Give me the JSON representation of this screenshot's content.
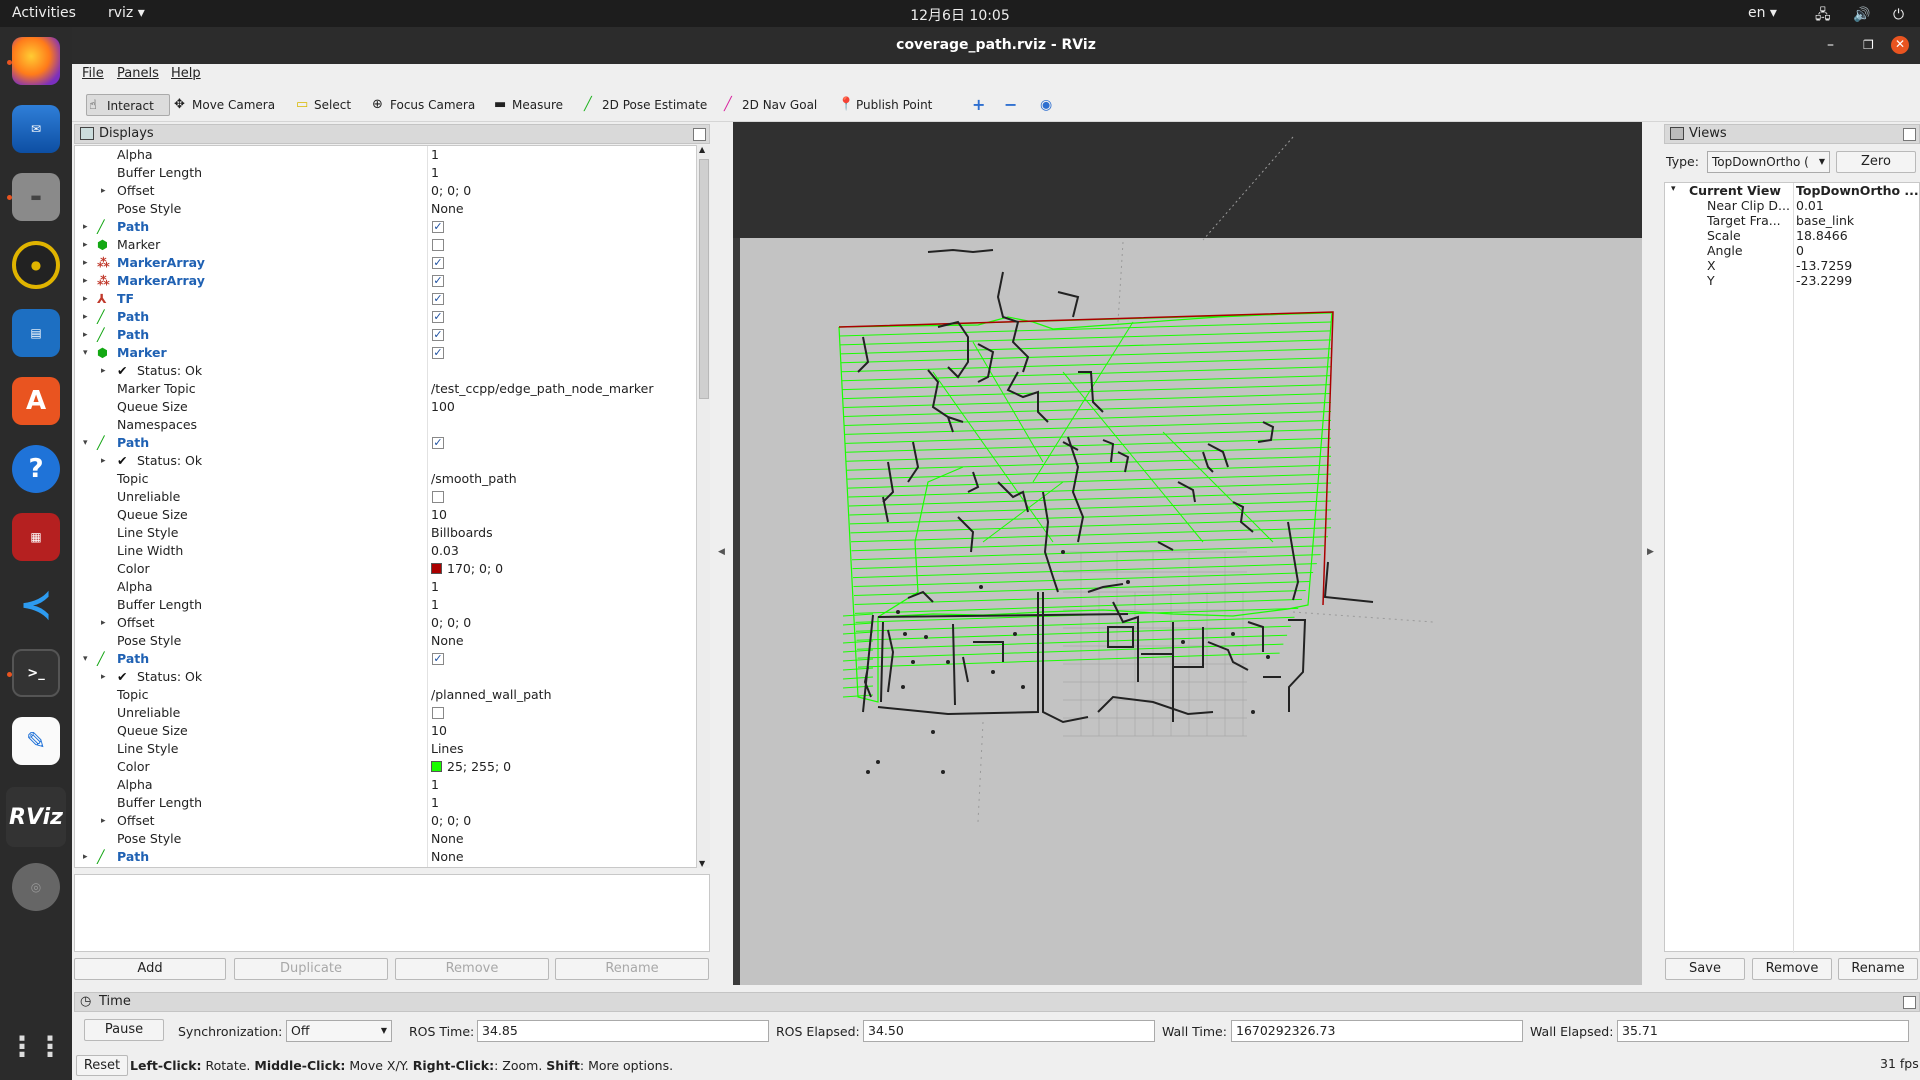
{
  "topbar": {
    "activities": "Activities",
    "app": "rviz ▾",
    "clock": "12月6日  10:05",
    "lang": "en ▾",
    "tray": "🖧 🔊 ⏻ ▾"
  },
  "window": {
    "title": "coverage_path.rviz - RViz"
  },
  "menu": {
    "file": "File",
    "panels": "Panels",
    "help": "Help"
  },
  "toolbar": {
    "interact": "Interact",
    "move_camera": "Move Camera",
    "select": "Select",
    "focus_camera": "Focus Camera",
    "measure": "Measure",
    "pose_estimate": "2D Pose Estimate",
    "nav_goal": "2D Nav Goal",
    "publish_point": "Publish Point"
  },
  "displays": {
    "header": "Displays",
    "rows": [
      {
        "name": "Alpha",
        "value": "1",
        "indent": 2
      },
      {
        "name": "Buffer Length",
        "value": "1",
        "indent": 2
      },
      {
        "name": "Offset",
        "value": "0; 0; 0",
        "indent": 2,
        "arrow": "▸"
      },
      {
        "name": "Pose Style",
        "value": "None",
        "indent": 2
      },
      {
        "name": "Path",
        "indent": 1,
        "arrow": "▸",
        "icon": "path",
        "blue": true,
        "check": true
      },
      {
        "name": "Marker",
        "indent": 1,
        "arrow": "▸",
        "icon": "marker",
        "check": false
      },
      {
        "name": "MarkerArray",
        "indent": 1,
        "arrow": "▸",
        "icon": "markerarray",
        "blue": true,
        "check": true
      },
      {
        "name": "MarkerArray",
        "indent": 1,
        "arrow": "▸",
        "icon": "markerarray",
        "blue": true,
        "check": true
      },
      {
        "name": "TF",
        "indent": 1,
        "arrow": "▸",
        "icon": "tf",
        "blue": true,
        "check": true
      },
      {
        "name": "Path",
        "indent": 1,
        "arrow": "▸",
        "icon": "path",
        "blue": true,
        "check": true
      },
      {
        "name": "Path",
        "indent": 1,
        "arrow": "▸",
        "icon": "path",
        "blue": true,
        "check": true
      },
      {
        "name": "Marker",
        "indent": 1,
        "arrow": "▾",
        "icon": "marker",
        "blue": true,
        "check": true
      },
      {
        "name": "Status: Ok",
        "indent": 2,
        "arrow": "▸",
        "icon": "status"
      },
      {
        "name": "Marker Topic",
        "value": "/test_ccpp/edge_path_node_marker",
        "indent": 2
      },
      {
        "name": "Queue Size",
        "value": "100",
        "indent": 2
      },
      {
        "name": "Namespaces",
        "value": "",
        "indent": 2
      },
      {
        "name": "Path",
        "indent": 1,
        "arrow": "▾",
        "icon": "path",
        "blue": true,
        "check": true
      },
      {
        "name": "Status: Ok",
        "indent": 2,
        "arrow": "▸",
        "icon": "status"
      },
      {
        "name": "Topic",
        "value": "/smooth_path",
        "indent": 2
      },
      {
        "name": "Unreliable",
        "indent": 2,
        "check": false
      },
      {
        "name": "Queue Size",
        "value": "10",
        "indent": 2
      },
      {
        "name": "Line Style",
        "value": "Billboards",
        "indent": 2
      },
      {
        "name": "Line Width",
        "value": "0.03",
        "indent": 2
      },
      {
        "name": "Color",
        "value": "170; 0; 0",
        "indent": 2,
        "swatch": "#aa0000"
      },
      {
        "name": "Alpha",
        "value": "1",
        "indent": 2
      },
      {
        "name": "Buffer Length",
        "value": "1",
        "indent": 2
      },
      {
        "name": "Offset",
        "value": "0; 0; 0",
        "indent": 2,
        "arrow": "▸"
      },
      {
        "name": "Pose Style",
        "value": "None",
        "indent": 2
      },
      {
        "name": "Path",
        "indent": 1,
        "arrow": "▾",
        "icon": "path",
        "blue": true,
        "check": true
      },
      {
        "name": "Status: Ok",
        "indent": 2,
        "arrow": "▸",
        "icon": "status"
      },
      {
        "name": "Topic",
        "value": "/planned_wall_path",
        "indent": 2
      },
      {
        "name": "Unreliable",
        "indent": 2,
        "check": false
      },
      {
        "name": "Queue Size",
        "value": "10",
        "indent": 2
      },
      {
        "name": "Line Style",
        "value": "Lines",
        "indent": 2
      },
      {
        "name": "Color",
        "value": "25; 255; 0",
        "indent": 2,
        "swatch": "#19ff00"
      },
      {
        "name": "Alpha",
        "value": "1",
        "indent": 2
      },
      {
        "name": "Buffer Length",
        "value": "1",
        "indent": 2
      },
      {
        "name": "Offset",
        "value": "0; 0; 0",
        "indent": 2,
        "arrow": "▸"
      },
      {
        "name": "Pose Style",
        "value": "None",
        "indent": 2
      },
      {
        "name": "Path",
        "value": "None",
        "indent": 1,
        "arrow": "▸",
        "icon": "path",
        "blue": true
      }
    ],
    "buttons": {
      "add": "Add",
      "duplicate": "Duplicate",
      "remove": "Remove",
      "rename": "Rename"
    }
  },
  "views": {
    "header": "Views",
    "type_label": "Type:",
    "type_value": "TopDownOrtho (",
    "zero": "Zero",
    "current_view": {
      "label": "Current View",
      "value": "TopDownOrtho ..."
    },
    "props": [
      {
        "name": "Near Clip D...",
        "value": "0.01"
      },
      {
        "name": "Target Fra...",
        "value": "base_link"
      },
      {
        "name": "Scale",
        "value": "18.8466"
      },
      {
        "name": "Angle",
        "value": "0"
      },
      {
        "name": "X",
        "value": "-13.7259"
      },
      {
        "name": "Y",
        "value": "-23.2299"
      }
    ],
    "buttons": {
      "save": "Save",
      "remove": "Remove",
      "rename": "Rename"
    }
  },
  "time": {
    "header": "Time",
    "pause": "Pause",
    "sync_label": "Synchronization:",
    "sync_value": "Off",
    "ros_time_label": "ROS Time:",
    "ros_time": "34.85",
    "ros_elapsed_label": "ROS Elapsed:",
    "ros_elapsed": "34.50",
    "wall_time_label": "Wall Time:",
    "wall_time": "1670292326.73",
    "wall_elapsed_label": "Wall Elapsed:",
    "wall_elapsed": "35.71"
  },
  "status": {
    "reset": "Reset",
    "hint_b1": "Left-Click:",
    "hint_t1": " Rotate. ",
    "hint_b2": "Middle-Click:",
    "hint_t2": " Move X/Y. ",
    "hint_b3": "Right-Click:",
    "hint_t3": ": Zoom. ",
    "hint_b4": "Shift",
    "hint_t4": ": More options.",
    "fps": "31 fps"
  },
  "colors": {
    "path_green": "#19ff00",
    "path_red": "#aa0000",
    "map_free": "#c3c3c3",
    "accent": "#e95420"
  }
}
